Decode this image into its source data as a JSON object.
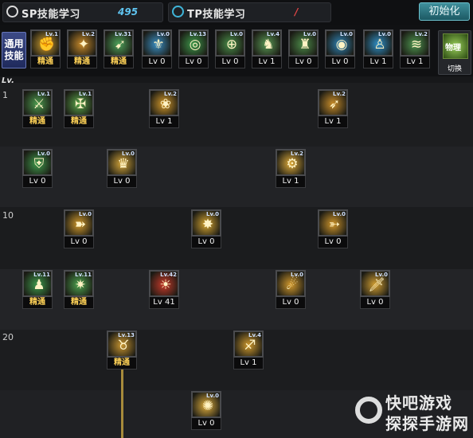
{
  "header": {
    "sp_label": "SP技能学习",
    "sp_value": "495",
    "tp_label": "TP技能学习",
    "tp_value": "/",
    "init_button": "初始化"
  },
  "quickbar": {
    "common_label_1": "通用",
    "common_label_2": "技能",
    "switch_label": "切换",
    "switch_icon_text": "物理",
    "slots": [
      {
        "small": "Lv.1",
        "level": "精通",
        "master": true,
        "icon": "arms-flex-icon",
        "glyph": "✊",
        "color": "#d6a431"
      },
      {
        "small": "Lv.2",
        "level": "精通",
        "master": true,
        "icon": "gold-burst-icon",
        "glyph": "✦",
        "color": "#c98b2a"
      },
      {
        "small": "Lv.31",
        "level": "精通",
        "master": true,
        "icon": "green-strike-icon",
        "glyph": "➹",
        "color": "#4fa35b"
      },
      {
        "small": "Lv.0",
        "level": "Lv 0",
        "master": false,
        "icon": "blue-wings-icon",
        "glyph": "⚜",
        "color": "#3a8fc4"
      },
      {
        "small": "Lv.13",
        "level": "Lv 0",
        "master": false,
        "icon": "green-target-icon",
        "glyph": "◎",
        "color": "#3f9a4c"
      },
      {
        "small": "Lv.0",
        "level": "Lv 0",
        "master": false,
        "icon": "target-cross-icon",
        "glyph": "⊕",
        "color": "#4a8f4a"
      },
      {
        "small": "Lv.4",
        "level": "Lv 1",
        "master": false,
        "icon": "warrior-stance-icon",
        "glyph": "♞",
        "color": "#5a9a55"
      },
      {
        "small": "Lv.0",
        "level": "Lv 0",
        "master": false,
        "icon": "flex-green-icon",
        "glyph": "♜",
        "color": "#4d8d4a"
      },
      {
        "small": "Lv.0",
        "level": "Lv 0",
        "master": false,
        "icon": "blue-eye-icon",
        "glyph": "◉",
        "color": "#2f84b6"
      },
      {
        "small": "Lv.0",
        "level": "Lv 1",
        "master": false,
        "icon": "blue-figure-icon",
        "glyph": "♙",
        "color": "#2f90c9"
      },
      {
        "small": "Lv.2",
        "level": "Lv 1",
        "master": false,
        "icon": "green-stripes-icon",
        "glyph": "≋",
        "color": "#4e9650"
      }
    ]
  },
  "tree": {
    "header": "Lv.",
    "row_labels": {
      "r1": "1",
      "r10": "10",
      "r20": "20"
    },
    "skills": [
      {
        "id": "s1",
        "small": "Lv.1",
        "level": "精通",
        "master": true,
        "icon": "green-slash-icon",
        "glyph": "⚔",
        "color": "#4d9b4f"
      },
      {
        "id": "s2",
        "small": "Lv.1",
        "level": "精通",
        "master": true,
        "icon": "green-cross-icon",
        "glyph": "✠",
        "color": "#5aa54a"
      },
      {
        "id": "s3",
        "small": "Lv.2",
        "level": "Lv 1",
        "master": false,
        "icon": "gold-claw-icon",
        "glyph": "❀",
        "color": "#d59a2b"
      },
      {
        "id": "s4",
        "small": "Lv.2",
        "level": "Lv 1",
        "master": false,
        "icon": "gold-kick-icon",
        "glyph": "➶",
        "color": "#c98d2a"
      },
      {
        "id": "s5",
        "small": "Lv.0",
        "level": "Lv 0",
        "master": false,
        "icon": "green-shield-on-icon",
        "glyph": "⛨",
        "color": "#3f9a4c"
      },
      {
        "id": "s6",
        "small": "Lv.0",
        "level": "Lv 0",
        "master": false,
        "icon": "gold-crown-icon",
        "glyph": "♛",
        "color": "#d5a63a"
      },
      {
        "id": "s7",
        "small": "Lv.2",
        "level": "Lv 1",
        "master": false,
        "icon": "gold-gear-icon",
        "glyph": "⚙",
        "color": "#e0ac3a"
      },
      {
        "id": "s8",
        "small": "Lv.0",
        "level": "Lv 0",
        "master": false,
        "icon": "gold-dash-icon",
        "glyph": "➽",
        "color": "#d19a2d"
      },
      {
        "id": "s9",
        "small": "Lv.0",
        "level": "Lv 0",
        "master": false,
        "icon": "gold-burst2-icon",
        "glyph": "✸",
        "color": "#d6a531"
      },
      {
        "id": "s10",
        "small": "Lv.0",
        "level": "Lv 0",
        "master": false,
        "icon": "gold-rush-icon",
        "glyph": "➳",
        "color": "#d0962b"
      },
      {
        "id": "s11",
        "small": "Lv.11",
        "level": "精通",
        "master": true,
        "icon": "green-figure-icon",
        "glyph": "♟",
        "color": "#3f9a4c"
      },
      {
        "id": "s12",
        "small": "Lv.11",
        "level": "精通",
        "master": true,
        "icon": "green-star-icon",
        "glyph": "✷",
        "color": "#4da34f"
      },
      {
        "id": "s13",
        "small": "Lv.42",
        "level": "Lv 41",
        "master": false,
        "icon": "red-demon-icon",
        "glyph": "☀",
        "color": "#c83a2a"
      },
      {
        "id": "s14",
        "small": "Lv.0",
        "level": "Lv 0",
        "master": false,
        "icon": "gold-wave-icon",
        "glyph": "☄",
        "color": "#d39a2d"
      },
      {
        "id": "s15",
        "small": "Lv.0",
        "level": "Lv 0",
        "master": false,
        "icon": "gold-sword-icon",
        "glyph": "🗡",
        "color": "#d4a033"
      },
      {
        "id": "s16",
        "small": "Lv.13",
        "level": "精通",
        "master": true,
        "icon": "gold-beast-icon",
        "glyph": "♉",
        "color": "#c89530"
      },
      {
        "id": "s17",
        "small": "Lv.4",
        "level": "Lv 1",
        "master": false,
        "icon": "gold-runner-icon",
        "glyph": "♐",
        "color": "#d09a2e"
      },
      {
        "id": "s18",
        "small": "Lv.0",
        "level": "Lv 0",
        "master": false,
        "icon": "gold-fan-icon",
        "glyph": "✺",
        "color": "#e0ae3d"
      }
    ]
  },
  "watermark": {
    "line1": "快吧游戏",
    "line2": "探探手游网"
  }
}
